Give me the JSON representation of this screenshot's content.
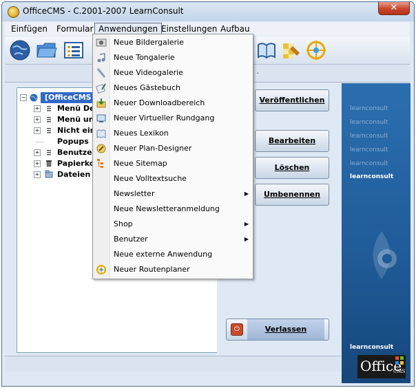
{
  "window": {
    "title": "OfficeCMS - C.2001-2007 LearnConsult",
    "close_glyph": "✕"
  },
  "menubar": [
    {
      "label": "Einfügen"
    },
    {
      "label": "Formular"
    },
    {
      "label": "Anwendungen"
    },
    {
      "label": "Einstellungen"
    },
    {
      "label": "Aufbau"
    }
  ],
  "addressbar": {
    "suffix": "n ·"
  },
  "tree": {
    "root": "[OfficeCMS",
    "items": [
      "Menü De",
      "Menü unt",
      "Nicht ein",
      "Popups",
      "Benutzer",
      "Papierko",
      "Dateien"
    ]
  },
  "buttons": {
    "publish": "Veröffentlichen",
    "edit": "Bearbeiten",
    "delete": "Löschen",
    "rename": "Umbenennen",
    "leave": "Verlassen"
  },
  "brand": {
    "tag": "learnconsult",
    "office": "Office",
    "cms": "CMS"
  },
  "dropdown": {
    "items": [
      {
        "label": "Neue Bildergalerie",
        "icon": "gallery-icon",
        "submenu": false
      },
      {
        "label": "Neue Tongalerie",
        "icon": "music-icon",
        "submenu": false
      },
      {
        "label": "Neue Videogalerie",
        "icon": "video-icon",
        "submenu": false
      },
      {
        "label": "Neues Gästebuch",
        "icon": "guestbook-icon",
        "submenu": false
      },
      {
        "label": "Neuer Downloadbereich",
        "icon": "download-icon",
        "submenu": false
      },
      {
        "label": "Neuer Virtueller Rundgang",
        "icon": "tour-icon",
        "submenu": false
      },
      {
        "label": "Neues Lexikon",
        "icon": "lexicon-icon",
        "submenu": false
      },
      {
        "label": "Neuer Plan-Designer",
        "icon": "plan-icon",
        "submenu": false
      },
      {
        "label": "Neue Sitemap",
        "icon": "sitemap-icon",
        "submenu": false
      },
      {
        "label": "Neue Volltextsuche",
        "icon": "",
        "submenu": false
      },
      {
        "label": "Newsletter",
        "icon": "",
        "submenu": true
      },
      {
        "label": "Neue Newsletteranmeldung",
        "icon": "",
        "submenu": false
      },
      {
        "label": "Shop",
        "icon": "",
        "submenu": true
      },
      {
        "label": "Benutzer",
        "icon": "",
        "submenu": true
      },
      {
        "label": "Neue externe Anwendung",
        "icon": "",
        "submenu": false
      },
      {
        "label": "Neuer Routenplaner",
        "icon": "compass-icon",
        "submenu": false
      }
    ],
    "submenu_arrow": "▶"
  },
  "colors": {
    "brand_blue": "#1f5a96",
    "menu_hover": "#e4ebf5"
  }
}
